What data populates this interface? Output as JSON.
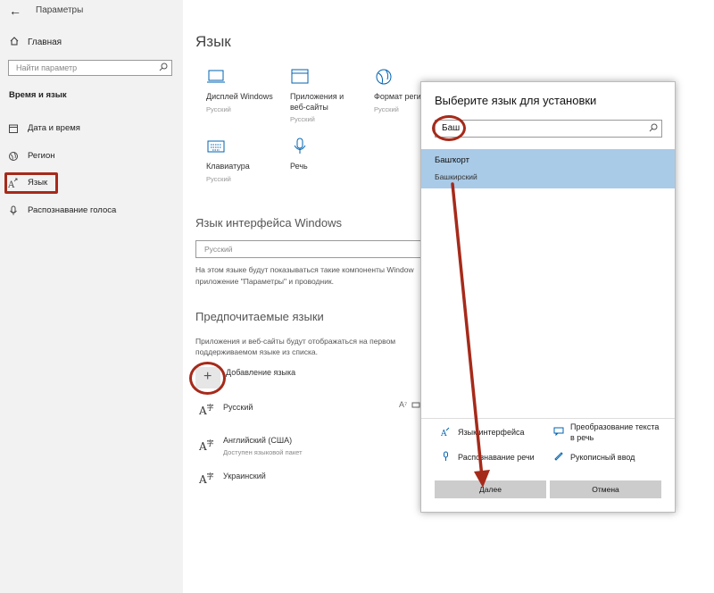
{
  "window": {
    "back_glyph": "←",
    "title": "Параметры"
  },
  "sidebar": {
    "home": "Главная",
    "search_placeholder": "Найти параметр",
    "section": "Время и язык",
    "items": [
      {
        "label": "Дата и время",
        "icon": "calendar-icon"
      },
      {
        "label": "Регион",
        "icon": "globe-icon"
      },
      {
        "label": "Язык",
        "icon": "language-icon"
      },
      {
        "label": "Распознавание голоса",
        "icon": "microphone-icon"
      }
    ]
  },
  "main": {
    "title": "Язык",
    "tiles": [
      {
        "name": "Дисплей Windows",
        "sub": "Русский",
        "icon": "monitor-icon"
      },
      {
        "name": "Приложения и веб-сайты",
        "sub": "Русский",
        "icon": "window-icon"
      },
      {
        "name": "Формат регио",
        "sub": "Русский",
        "icon": "globe-icon"
      },
      {
        "name": "Клавиатура",
        "sub": "Русский",
        "icon": "keyboard-icon"
      },
      {
        "name": "Речь",
        "sub": "",
        "icon": "microphone-icon"
      }
    ],
    "interface_heading": "Язык интерфейса Windows",
    "interface_value": "Русский",
    "interface_desc_1": "На этом языке будут показываться такие компоненты Window",
    "interface_desc_2": "приложение \"Параметры\" и проводник.",
    "preferred_heading": "Предпочитаемые языки",
    "preferred_desc_1": "Приложения и веб-сайты будут отображаться на первом",
    "preferred_desc_2": "поддерживаемом языке из списка.",
    "add_label": "Добавление языка",
    "languages": [
      {
        "name": "Русский",
        "sub": ""
      },
      {
        "name": "Английский (США)",
        "sub": "Доступен языковой пакет"
      },
      {
        "name": "Украинский",
        "sub": ""
      }
    ]
  },
  "dialog": {
    "title": "Выберите язык для установки",
    "search_value": "Баш",
    "result_native": "Башҡорт",
    "result_local": "Башкирский",
    "features": [
      "Язык интерфейса",
      "Распознавание речи",
      "Преобразование текста в речь",
      "Рукописный ввод"
    ],
    "next": "Далее",
    "cancel": "Отмена"
  },
  "colors": {
    "highlight_ring": "#a62a1a",
    "selected_row": "#a9cbe8",
    "accent_icon": "#0063b1"
  }
}
